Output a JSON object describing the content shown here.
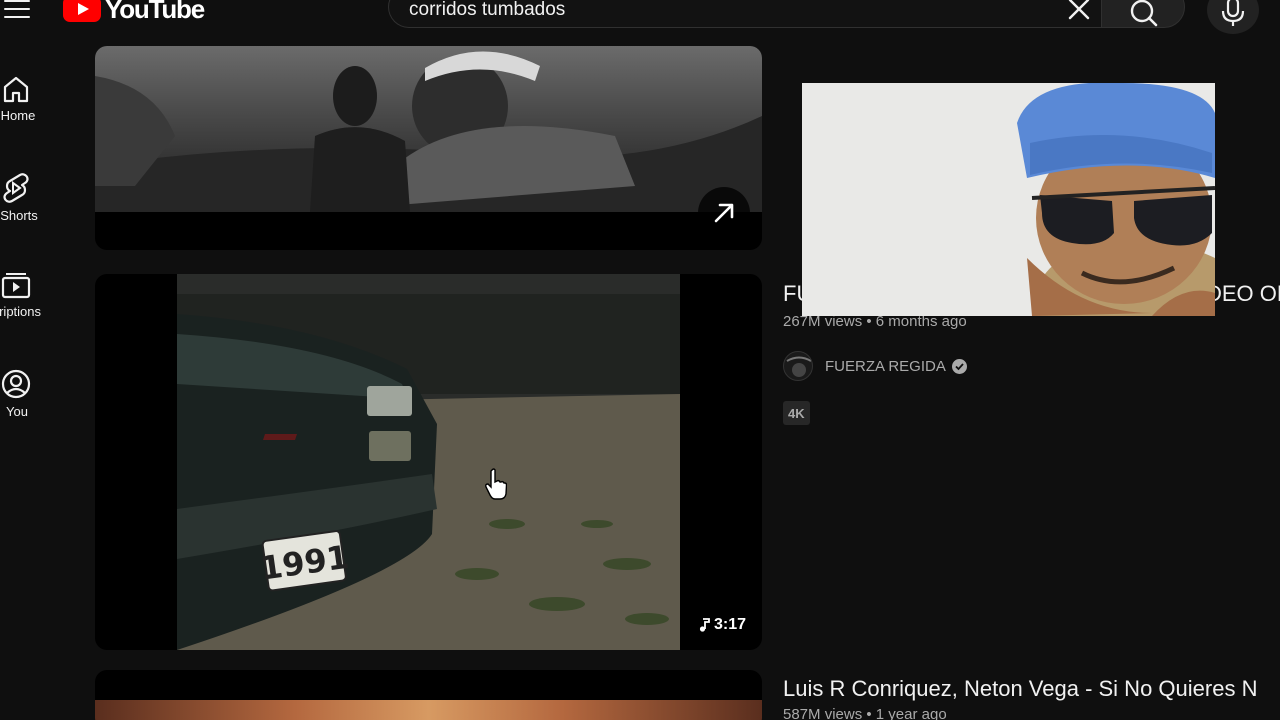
{
  "header": {
    "logo_text": "YouTube",
    "search_value": "corridos tumbados",
    "icons": [
      "menu-icon",
      "youtube-logo-icon",
      "close-icon",
      "search-icon",
      "mic-icon"
    ]
  },
  "sidebar": {
    "items": [
      {
        "label": "Home",
        "icon": "home-icon"
      },
      {
        "label": "Shorts",
        "icon": "shorts-icon"
      },
      {
        "label": "Subscriptions",
        "icon": "subscriptions-icon"
      },
      {
        "label": "You",
        "icon": "you-icon"
      }
    ]
  },
  "videos": [
    {
      "thumbnail_control": "expand-icon"
    },
    {
      "title": "FUERZA REGIDA - ... VIDEO OFICIAL",
      "title_visible_left": "FU",
      "title_visible_right": "DEO OF",
      "views": "267M views",
      "age": "6 months ago",
      "channel": "FUERZA REGIDA",
      "verified": true,
      "badge": "4K",
      "duration": "3:17",
      "duration_icon": "music-note-icon",
      "plate_text": "1991"
    },
    {
      "title": "Luis R Conriquez, Neton Vega - Si No Quieres N",
      "views": "587M views",
      "age": "1 year ago"
    }
  ],
  "colors": {
    "background": "#0f0f0f",
    "brand_red": "#ff0000",
    "text_primary": "#f1f1f1",
    "text_secondary": "#aaaaaa"
  }
}
